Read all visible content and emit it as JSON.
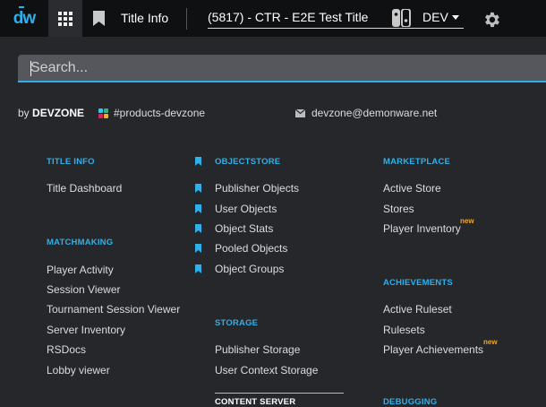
{
  "header": {
    "logo": "dw",
    "title_info_label": "Title Info",
    "selected_title": "(5817) - CTR - E2E Test Title",
    "environment": "DEV"
  },
  "search": {
    "placeholder": "Search..."
  },
  "byline": {
    "by_prefix": "by",
    "by_name": "DEVZONE",
    "slack_channel": "#products-devzone",
    "email": "devzone@demonware.net"
  },
  "colors": {
    "accent": "#2fb0ea",
    "new_badge": "#f5a623",
    "background": "#25272b",
    "topbar": "#0f1012"
  },
  "menu": {
    "title_info": {
      "header": "TITLE INFO",
      "items": [
        "Title Dashboard"
      ]
    },
    "matchmaking": {
      "header": "MATCHMAKING",
      "items": [
        "Player Activity",
        "Session Viewer",
        "Tournament Session Viewer",
        "Server Inventory",
        "RSDocs",
        "Lobby viewer"
      ]
    },
    "objectstore": {
      "header": "OBJECTSTORE",
      "items": [
        "Publisher Objects",
        "User Objects",
        "Object Stats",
        "Pooled Objects",
        "Object Groups"
      ]
    },
    "storage": {
      "header": "STORAGE",
      "items": [
        "Publisher Storage",
        "User Context Storage"
      ]
    },
    "content_server": {
      "header": "CONTENT SERVER"
    },
    "marketplace": {
      "header": "MARKETPLACE",
      "items": [
        "Active Store",
        "Stores",
        "Player Inventory"
      ]
    },
    "achievements": {
      "header": "ACHIEVEMENTS",
      "items": [
        "Active Ruleset",
        "Rulesets",
        "Player Achievements"
      ]
    },
    "debugging": {
      "header": "DEBUGGING"
    },
    "new_badge": "new"
  }
}
